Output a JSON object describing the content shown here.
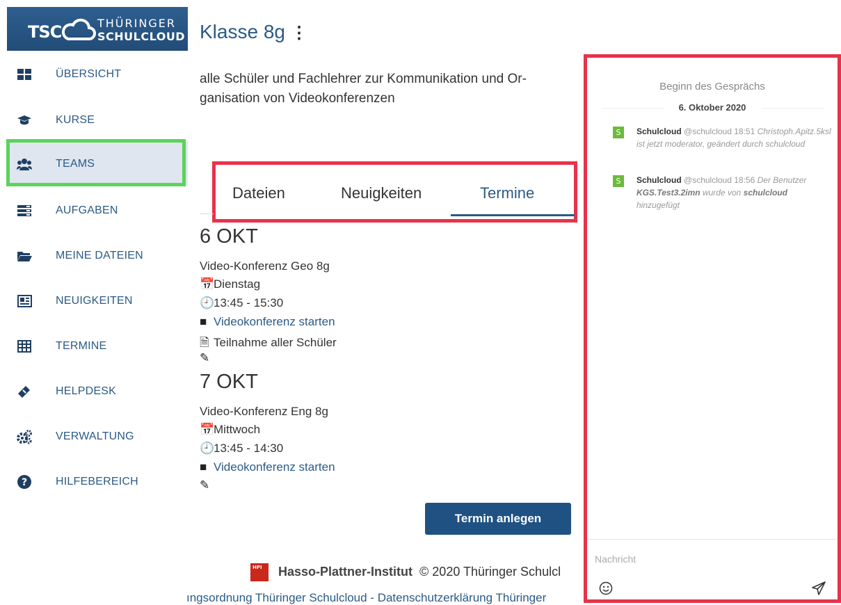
{
  "logo": {
    "short": "TSC",
    "line1": "THÜRINGER",
    "line2": "SCHULCLOUD"
  },
  "sidebar": {
    "items": [
      {
        "label": "ÜBERSICHT",
        "icon": "dashboard-icon"
      },
      {
        "label": "KURSE",
        "icon": "graduation-cap-icon"
      },
      {
        "label": "TEAMS",
        "icon": "users-icon",
        "active": true
      },
      {
        "label": "AUFGABEN",
        "icon": "tasks-icon"
      },
      {
        "label": "MEINE DATEIEN",
        "icon": "folder-open-icon"
      },
      {
        "label": "NEUIGKEITEN",
        "icon": "newspaper-icon"
      },
      {
        "label": "TERMINE",
        "icon": "table-icon"
      },
      {
        "label": "HELPDESK",
        "icon": "ticket-icon"
      },
      {
        "label": "VERWALTUNG",
        "icon": "cogs-icon"
      },
      {
        "label": "HILFEBEREICH",
        "icon": "question-circle-icon"
      }
    ]
  },
  "page": {
    "title": "Klasse 8g",
    "menu_dots": "⋮",
    "description_line1": "alle Schüler und Fachlehrer zur Kommunikation und Or-",
    "description_line2": "ganisation von Videokonferenzen"
  },
  "tabs": [
    {
      "label": "Dateien"
    },
    {
      "label": "Neuigkeiten"
    },
    {
      "label": "Termine",
      "active": true
    }
  ],
  "events": [
    {
      "day": "6 OKT",
      "title": "Video-Konferenz Geo 8g",
      "weekday": "Dienstag",
      "time": "13:45 - 15:30",
      "link": "Videokonferenz starten",
      "note": "Teilnahme aller Schüler"
    },
    {
      "day": "7 OKT",
      "title": "Video-Konferenz Eng 8g",
      "weekday": "Mittwoch",
      "time": "13:45 - 14:30",
      "link": "Videokonferenz starten"
    }
  ],
  "add_button": "Termin anlegen",
  "footer": {
    "hpi_label": "Hasso-Plattner-Institut",
    "copyright": "© 2020 Thüringer Schulcl",
    "links": "ıngsordnung Thüringer Schulcloud - Datenschutzerklärung Thüringer"
  },
  "chat": {
    "start": "Beginn des Gesprächs",
    "date": "6. Oktober 2020",
    "messages": [
      {
        "avatar": "S",
        "name": "Schulcloud",
        "handle": "@schulcloud",
        "time": "18:51",
        "text": "Christoph.Apitz.5ksl ist jetzt moderator, geändert durch schulcloud"
      },
      {
        "avatar": "S",
        "name": "Schulcloud",
        "handle": "@schulcloud",
        "time": "18:56",
        "text_pre": "Der Benutzer",
        "text_bold1": "KGS.Test3.2imn",
        "text_mid": "wurde von",
        "text_bold2": "schulcloud",
        "text_post": "hinzugefügt"
      }
    ],
    "placeholder": "Nachricht"
  }
}
